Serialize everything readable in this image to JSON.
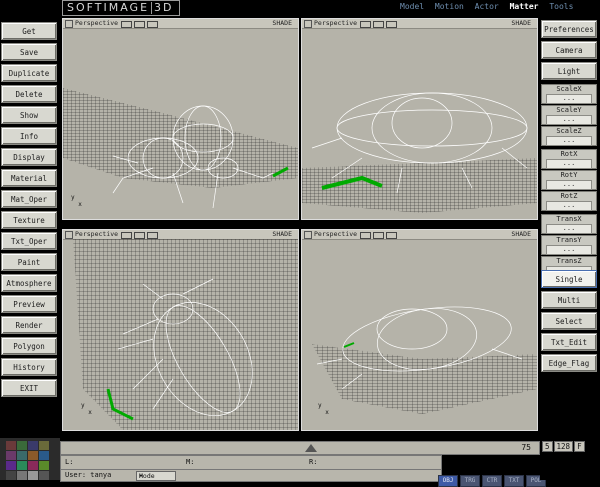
{
  "app": {
    "logo": "SOFTIMAGE",
    "logo_suffix": "3D",
    "modules": [
      "Model",
      "Motion",
      "Actor",
      "Matter",
      "Tools"
    ],
    "active_module": "Matter"
  },
  "left_menu": [
    "Get",
    "Save",
    "Duplicate",
    "Delete",
    "Show",
    "Info",
    "Display",
    "Material",
    "Mat_Oper",
    "Texture",
    "Txt_Oper",
    "Paint",
    "Atmosphere",
    "Preview",
    "Render",
    "Polygon",
    "History",
    "EXIT"
  ],
  "right_menu": {
    "top": [
      "Preferences",
      "Camera",
      "Light"
    ],
    "groups": [
      {
        "label": "ScaleX",
        "value": "..."
      },
      {
        "label": "ScaleY",
        "value": "..."
      },
      {
        "label": "ScaleZ",
        "value": "..."
      },
      {
        "label": "RotX",
        "value": "..."
      },
      {
        "label": "RotY",
        "value": "..."
      },
      {
        "label": "RotZ",
        "value": "..."
      },
      {
        "label": "TransX",
        "value": "..."
      },
      {
        "label": "TransY",
        "value": "..."
      },
      {
        "label": "TransZ",
        "value": "..."
      }
    ],
    "bottom": [
      "Single",
      "Multi",
      "Select",
      "Txt_Edit",
      "Edge_Flag"
    ],
    "active": "Single"
  },
  "viewports": [
    {
      "view": "Perspective",
      "mode": "SHADE",
      "axis_x": "x",
      "axis_y": "y"
    },
    {
      "view": "Perspective",
      "mode": "SHADE",
      "axis_x": "x",
      "axis_y": "y"
    },
    {
      "view": "Perspective",
      "mode": "SHADE",
      "axis_x": "x",
      "axis_y": "y"
    },
    {
      "view": "Perspective",
      "mode": "SHADE",
      "axis_x": "x",
      "axis_y": "y"
    }
  ],
  "timeline": {
    "frame": "75",
    "start": "5",
    "end": "128",
    "end_suffix": "F"
  },
  "status": {
    "L": "L:",
    "M": "M:",
    "R": "R:"
  },
  "user": {
    "label": "User: tanya",
    "mode_label": "Mode",
    "mode_value": "▾"
  },
  "tags": [
    "OBJ",
    "TRG",
    "CTR",
    "TXT",
    "POL"
  ],
  "active_tag": "OBJ"
}
